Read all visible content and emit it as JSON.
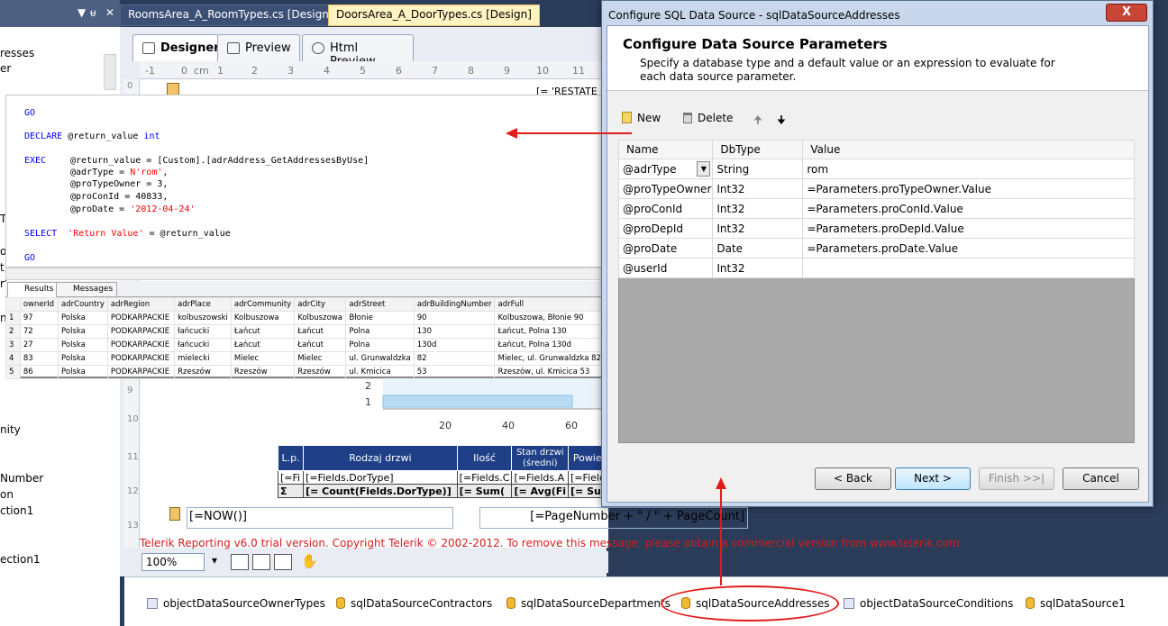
{
  "left_panel": {
    "title_icons": [
      "▼",
      "ᵾ",
      "✕"
    ],
    "items": [
      "resses",
      "er",
      "T",
      "or",
      "t,",
      "rt",
      "n 1",
      "nity",
      "Number",
      "on",
      "ction1",
      "ection1"
    ]
  },
  "tabs": [
    {
      "label": "RoomsArea_A_RoomTypes.cs [Design]"
    },
    {
      "label": "DoorsArea_A_DoorTypes.cs [Design]"
    }
  ],
  "designer_tabs": [
    "Designer",
    "Preview",
    "Html Preview"
  ],
  "ruler": {
    "labels": [
      "-1",
      "0",
      "cm",
      "1",
      "2",
      "3",
      "4",
      "5",
      "6",
      "7",
      "8",
      "9",
      "10",
      "11",
      "12"
    ]
  },
  "vruler": {
    "labels": [
      "0",
      "9",
      "10",
      "11",
      "12",
      "13"
    ]
  },
  "report_header_field": "[= 'RESTATE",
  "sql": {
    "go1": "GO",
    "declare_kw": "DECLARE",
    "declare_var": " @return_value ",
    "declare_type": "int",
    "exec_kw": "EXEC",
    "exec_line": "@return_value = [Custom].[adrAddress_GetAddressesByUse]",
    "param1_a": "@adrType = ",
    "param1_b": "N'rom'",
    "param1_c": ",",
    "param2": "@proTypeOwner = 3,",
    "param3": "@proConId = 40833,",
    "param4_a": "@proDate = ",
    "param4_b": "'2012-04-24'",
    "select_kw": "SELECT",
    "select_str": "'Return Value'",
    "select_rest": " = @return_value",
    "go2": "GO"
  },
  "results": {
    "tabs": [
      "Results",
      "Messages"
    ],
    "columns": [
      "",
      "ownerId",
      "adrCountry",
      "adrRegion",
      "adrPlace",
      "adrCommunity",
      "adrCity",
      "adrStreet",
      "adrBuildingNumber",
      "adrFull"
    ],
    "rows": [
      [
        "1",
        "97",
        "Polska",
        "PODKARPACKIE",
        "kolbuszowski",
        "Kolbuszowa",
        "Kolbuszowa",
        "Błonie",
        "90",
        "Kolbuszowa,  Błonie 90"
      ],
      [
        "2",
        "72",
        "Polska",
        "PODKARPACKIE",
        "łańcucki",
        "Łańcut",
        "Łańcut",
        "Polna",
        "130",
        "Łańcut,  Polna 130"
      ],
      [
        "3",
        "27",
        "Polska",
        "PODKARPACKIE",
        "łańcucki",
        "Łańcut",
        "Łańcut",
        "Polna",
        "130d",
        "Łańcut,  Polna 130d"
      ],
      [
        "4",
        "83",
        "Polska",
        "PODKARPACKIE",
        "mielecki",
        "Mielec",
        "Mielec",
        "ul. Grunwaldzka",
        "82",
        "Mielec, ul. Grunwaldzka 82"
      ],
      [
        "5",
        "86",
        "Polska",
        "PODKARPACKIE",
        "Rzeszów",
        "Rzeszów",
        "Rzeszów",
        "ul. Kmicica",
        "53",
        "Rzeszów, ul. Kmicica 53"
      ]
    ]
  },
  "mini_chart": {
    "y_labels": [
      "2",
      "1"
    ],
    "x_labels": [
      "20",
      "40",
      "60"
    ],
    "bar_value": 60
  },
  "report_table": {
    "headers": [
      "L.p.",
      "Rodzaj drzwi",
      "Ilość",
      "Stan drzwi (średni)",
      "Powier"
    ],
    "detail_row": [
      "[=Fi",
      "[=Fields.DorType]",
      "[=Fields.C",
      "[=Fields.A",
      "[=Field"
    ],
    "sum_row": [
      "Σ",
      "[= Count(Fields.DorType)]",
      "[= Sum(",
      "[= Avg(Fi",
      "[= Sur"
    ]
  },
  "footer": {
    "now": "[=NOW()]",
    "page": "[=PageNumber + \" / \" + PageCount]"
  },
  "trial_text": "Telerik Reporting v6.0 trial version. Copyright Telerik © 2002-2012. To remove this message, please obtain a commercial version from www.telerik.com",
  "zoom": "100%",
  "tray": [
    {
      "label": "objectDataSourceOwnerTypes",
      "kind": "object"
    },
    {
      "label": "sqlDataSourceContractors",
      "kind": "sql"
    },
    {
      "label": "sqlDataSourceDepartments",
      "kind": "sql"
    },
    {
      "label": "sqlDataSourceAddresses",
      "kind": "sql"
    },
    {
      "label": "objectDataSourceConditions",
      "kind": "object"
    },
    {
      "label": "sqlDataSource1",
      "kind": "sql"
    }
  ],
  "dialog": {
    "title": "Configure SQL Data Source - sqlDataSourceAddresses",
    "close": "X",
    "heading": "Configure Data Source Parameters",
    "description": "Specify a database type and a default value or an expression to evaluate for each data source parameter.",
    "toolbar": {
      "new": "New",
      "delete": "Delete",
      "up": "🠉",
      "down": "🠋"
    },
    "columns": [
      "Name",
      "DbType",
      "Value"
    ],
    "params": [
      {
        "name": "@adrType",
        "type": "String",
        "value": "rom"
      },
      {
        "name": "@proTypeOwner",
        "type": "Int32",
        "value": "=Parameters.proTypeOwner.Value"
      },
      {
        "name": "@proConId",
        "type": "Int32",
        "value": "=Parameters.proConId.Value"
      },
      {
        "name": "@proDepId",
        "type": "Int32",
        "value": "=Parameters.proDepId.Value"
      },
      {
        "name": "@proDate",
        "type": "Date",
        "value": "=Parameters.proDate.Value"
      },
      {
        "name": "@userId",
        "type": "Int32",
        "value": ""
      }
    ],
    "buttons": {
      "back": "< Back",
      "next": "Next >",
      "finish": "Finish >>|",
      "cancel": "Cancel"
    }
  },
  "colors": {
    "annotation": "#e21b1b",
    "header_blue": "#1f3f86",
    "trial_red": "#d21d1d"
  }
}
